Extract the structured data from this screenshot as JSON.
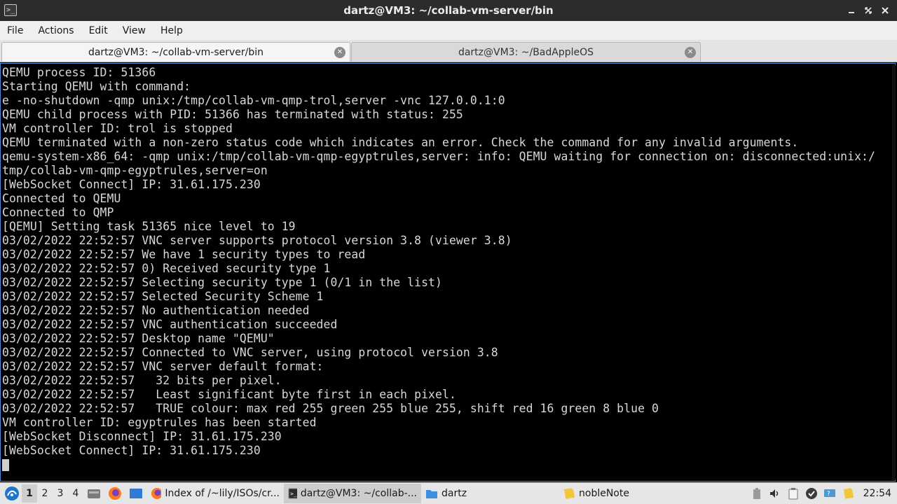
{
  "window": {
    "title": "dartz@VM3: ~/collab-vm-server/bin"
  },
  "menu": [
    "File",
    "Actions",
    "Edit",
    "View",
    "Help"
  ],
  "tabs": [
    {
      "label": "dartz@VM3: ~/collab-vm-server/bin",
      "active": true
    },
    {
      "label": "dartz@VM3: ~/BadAppleOS",
      "active": false
    }
  ],
  "terminal": {
    "lines": [
      "QEMU process ID: 51366",
      "Starting QEMU with command:",
      "e -no-shutdown -qmp unix:/tmp/collab-vm-qmp-trol,server -vnc 127.0.0.1:0",
      "QEMU child process with PID: 51366 has terminated with status: 255",
      "VM controller ID: trol is stopped",
      "QEMU terminated with a non-zero status code which indicates an error. Check the command for any invalid arguments.",
      "qemu-system-x86_64: -qmp unix:/tmp/collab-vm-qmp-egyptrules,server: info: QEMU waiting for connection on: disconnected:unix:/",
      "tmp/collab-vm-qmp-egyptrules,server=on",
      "[WebSocket Connect] IP: 31.61.175.230",
      "Connected to QEMU",
      "Connected to QMP",
      "[QEMU] Setting task 51365 nice level to 19",
      "03/02/2022 22:52:57 VNC server supports protocol version 3.8 (viewer 3.8)",
      "03/02/2022 22:52:57 We have 1 security types to read",
      "03/02/2022 22:52:57 0) Received security type 1",
      "03/02/2022 22:52:57 Selecting security type 1 (0/1 in the list)",
      "03/02/2022 22:52:57 Selected Security Scheme 1",
      "03/02/2022 22:52:57 No authentication needed",
      "03/02/2022 22:52:57 VNC authentication succeeded",
      "03/02/2022 22:52:57 Desktop name \"QEMU\"",
      "03/02/2022 22:52:57 Connected to VNC server, using protocol version 3.8",
      "03/02/2022 22:52:57 VNC server default format:",
      "03/02/2022 22:52:57   32 bits per pixel.",
      "03/02/2022 22:52:57   Least significant byte first in each pixel.",
      "03/02/2022 22:52:57   TRUE colour: max red 255 green 255 blue 255, shift red 16 green 8 blue 0",
      "VM controller ID: egyptrules has been started",
      "[WebSocket Disconnect] IP: 31.61.175.230",
      "[WebSocket Connect] IP: 31.61.175.230"
    ]
  },
  "taskbar": {
    "desktops": [
      "1",
      "2",
      "3",
      "4"
    ],
    "tasks": [
      {
        "label": "Index of /~lily/ISOs/cr...",
        "icon": "firefox-icon"
      },
      {
        "label": "dartz@VM3: ~/collab-...",
        "icon": "terminal-icon"
      },
      {
        "label": "dartz",
        "icon": "folder-icon"
      },
      {
        "label": "nobleNote",
        "icon": "note-icon"
      }
    ],
    "clock": "22:54"
  },
  "colors": {
    "terminal_bg": "#000000",
    "terminal_fg": "#d8d8d8",
    "titlebar_bg": "#2b2c2e",
    "terminal_border": "#4a90d9"
  }
}
